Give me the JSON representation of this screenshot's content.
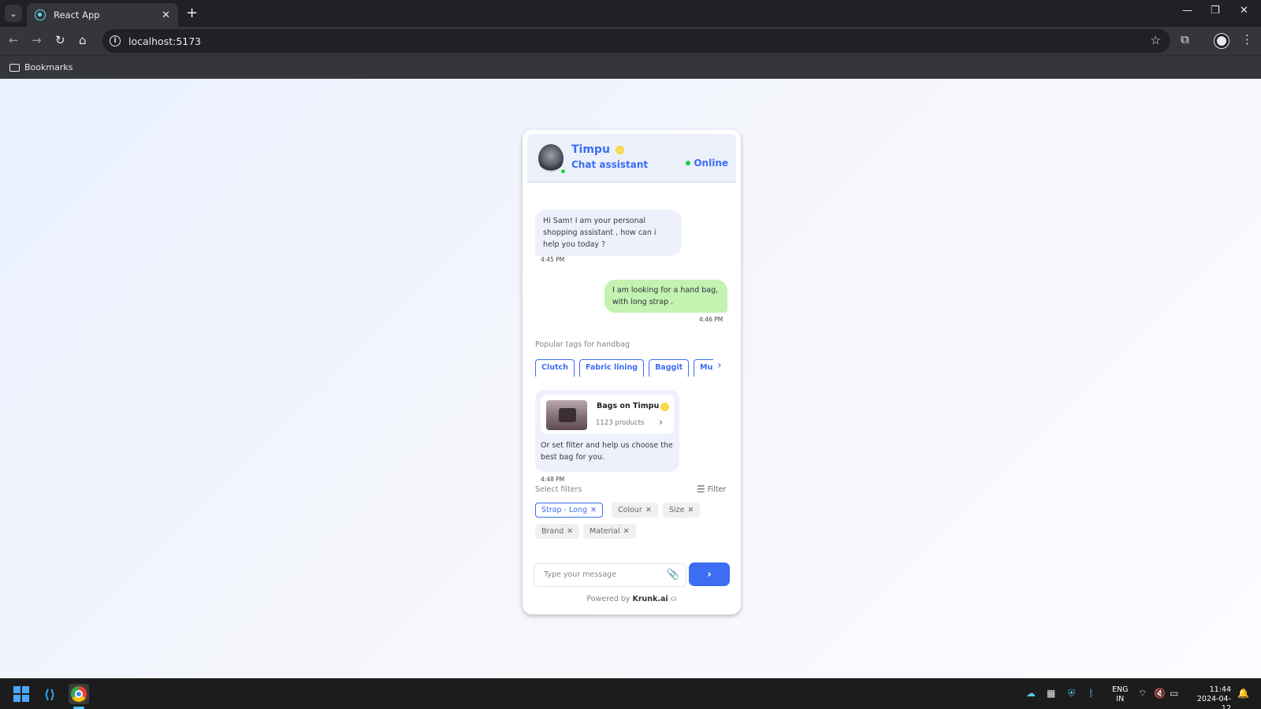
{
  "browser": {
    "tab_title": "React App",
    "url": "localhost:5173",
    "bookmarks_label": "Bookmarks"
  },
  "chat": {
    "header": {
      "name": "Timpu",
      "role": "Chat assistant",
      "status": "Online"
    },
    "messages": [
      {
        "from": "bot",
        "text": "Hi Sam! I am your personal shopping assistant , how can i help you today ?",
        "time": "4:45 PM"
      },
      {
        "from": "user",
        "text": "I am looking for a hand bag, with long strap .",
        "time": "4:46 PM"
      }
    ],
    "tags": {
      "title": "Popular tags for handbag",
      "items": [
        "Clutch",
        "Fabric lining",
        "Baggit",
        "Multi"
      ]
    },
    "product_message": {
      "store_name": "Bags on Timpu",
      "product_count": "1123 products",
      "text": "Or set filter and help us choose the best bag for you.",
      "time": "4:48 PM"
    },
    "filters": {
      "title": "Select filters",
      "button_label": "Filter",
      "chips": [
        {
          "label": "Strap - Long",
          "selected": true
        },
        {
          "label": "Colour",
          "selected": false
        },
        {
          "label": "Size",
          "selected": false
        },
        {
          "label": "Brand",
          "selected": false
        },
        {
          "label": "Material",
          "selected": false
        }
      ]
    },
    "composer": {
      "placeholder": "Type your message"
    },
    "powered_by": {
      "prefix": "Powered by",
      "brand": "Krunk.ai"
    }
  },
  "taskbar": {
    "language_top": "ENG",
    "language_bottom": "IN",
    "time": "11:44",
    "date": "2024-04-12"
  },
  "colors": {
    "accent": "#3d6df2",
    "online": "#1fce44",
    "user_bubble": "#c4f2b0",
    "bot_bubble": "#eef1fb"
  }
}
